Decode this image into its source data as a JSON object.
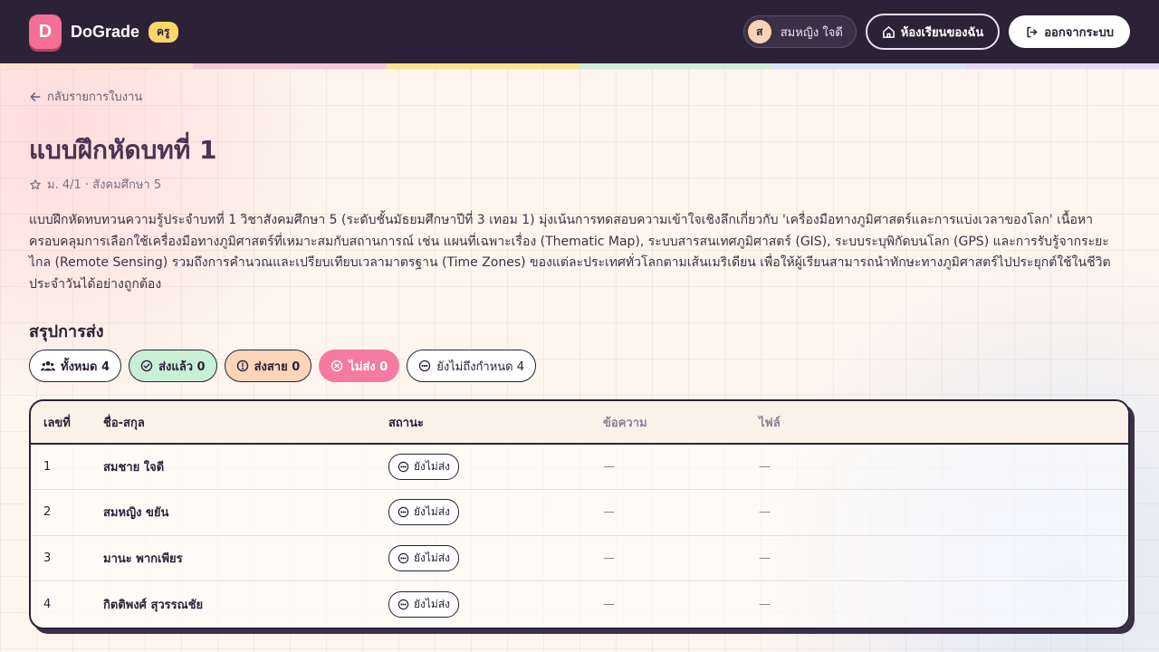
{
  "header": {
    "logo_letter": "D",
    "brand": "DoGrade",
    "role": "ครู",
    "user_initial": "ส",
    "user_name": "สมหญิง ใจดี",
    "my_class_label": "ห้องเรียนของฉัน",
    "logout_label": "ออกจากระบบ"
  },
  "rainbow_colors": [
    "#fde0cf",
    "#f8c6d6",
    "#fce48a",
    "#cfeed8",
    "#d6e4fb",
    "#e4d6f8"
  ],
  "back_label": "กลับรายการใบงาน",
  "assignment": {
    "title": "แบบฝึกหัดบทที่ 1",
    "meta": "ม. 4/1 · สังคมศึกษา 5",
    "description": "แบบฝึกหัดทบทวนความรู้ประจำบทที่ 1 วิชาสังคมศึกษา 5 (ระดับชั้นมัธยมศึกษาปีที่ 3 เทอม 1) มุ่งเน้นการทดสอบความเข้าใจเชิงลึกเกี่ยวกับ 'เครื่องมือทางภูมิศาสตร์และการแบ่งเวลาของโลก' เนื้อหาครอบคลุมการเลือกใช้เครื่องมือทางภูมิศาสตร์ที่เหมาะสมกับสถานการณ์ เช่น แผนที่เฉพาะเรื่อง (Thematic Map), ระบบสารสนเทศภูมิศาสตร์ (GIS), ระบบระบุพิกัดบนโลก (GPS) และการรับรู้จากระยะไกล (Remote Sensing) รวมถึงการคำนวณและเปรียบเทียบเวลามาตรฐาน (Time Zones) ของแต่ละประเทศทั่วโลกตามเส้นเมริเดียน เพื่อให้ผู้เรียนสามารถนำทักษะทางภูมิศาสตร์ไปประยุกต์ใช้ในชีวิตประจำวันได้อย่างถูกต้อง"
  },
  "summary": {
    "title": "สรุปการส่ง",
    "all": "ทั้งหมด 4",
    "submitted": "ส่งแล้ว 0",
    "late": "ส่งสาย 0",
    "missing": "ไม่ส่ง 0",
    "pending": "ยังไม่ถึงกำหนด 4"
  },
  "table": {
    "headers": [
      "เลขที่",
      "ชื่อ-สกุล",
      "สถานะ",
      "ข้อความ",
      "ไฟล์"
    ],
    "rows": [
      {
        "no": "1",
        "name": "สมชาย ใจดี",
        "status": "ยังไม่ส่ง",
        "message": "—",
        "file": "—"
      },
      {
        "no": "2",
        "name": "สมหญิง ขยัน",
        "status": "ยังไม่ส่ง",
        "message": "—",
        "file": "—"
      },
      {
        "no": "3",
        "name": "มานะ พากเพียร",
        "status": "ยังไม่ส่ง",
        "message": "—",
        "file": "—"
      },
      {
        "no": "4",
        "name": "กิตติพงศ์ สุวรรณชัย",
        "status": "ยังไม่ส่ง",
        "message": "—",
        "file": "—"
      }
    ]
  }
}
